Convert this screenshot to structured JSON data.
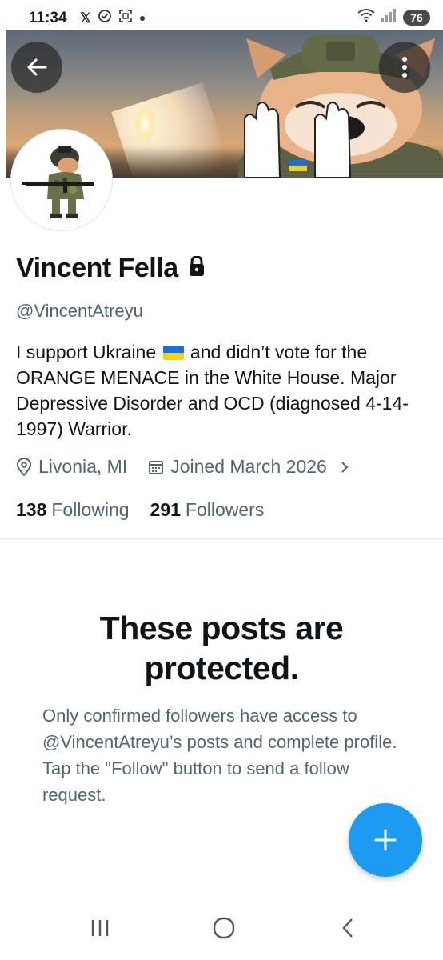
{
  "status_bar": {
    "time": "11:34",
    "battery": "76",
    "left_icons": [
      "x-icon",
      "check-circle-icon",
      "screenshot-icon",
      "dot-icon"
    ],
    "right_icons": [
      "wifi-icon",
      "signal-icon",
      "battery-icon"
    ]
  },
  "profile": {
    "display_name": "Vincent Fella",
    "handle": "@VincentAtreyu",
    "bio_part1": "I support Ukraine",
    "bio_part2": "and didn’t vote for the ORANGE MENACE in the White House. Major Depressive Disorder and OCD (diagnosed 4-14-1997) Warrior.",
    "location": "Livonia, MI",
    "joined": "Joined March 2026",
    "following_count": "138",
    "following_label": "Following",
    "followers_count": "291",
    "followers_label": "Followers"
  },
  "protected": {
    "title": "These posts are protected.",
    "description": "Only confirmed followers have access to @VincentAtreyu’s posts and complete profile. Tap the \"Follow\" button to send a follow request."
  },
  "colors": {
    "accent": "#1d9bf0",
    "secondary_text": "#536471",
    "primary_text": "#0f1419"
  }
}
